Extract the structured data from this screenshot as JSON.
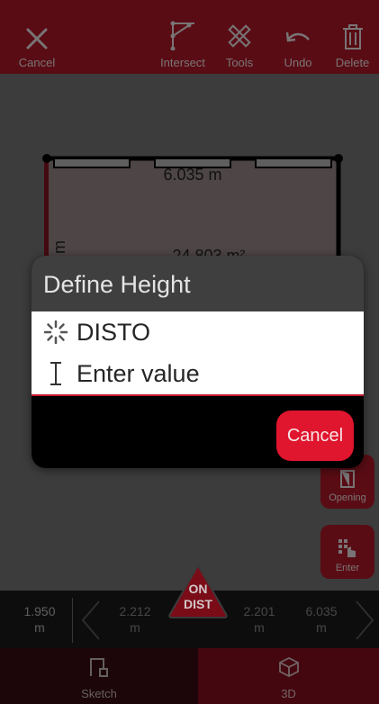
{
  "toolbar": {
    "cancel_label": "Cancel",
    "intersect_label": "Intersect",
    "tools_label": "Tools",
    "undo_label": "Undo",
    "delete_label": "Delete",
    "icons": {
      "cancel": "close-icon",
      "intersect": "intersect-icon",
      "tools": "tools-icon",
      "undo": "undo-icon",
      "delete": "trash-icon"
    }
  },
  "sketch": {
    "top_wall_length": "6.035 m",
    "left_wall_length": "399 m",
    "area": "24.803 m²"
  },
  "side_buttons": {
    "opening_label": "Opening",
    "enter_label": "Enter"
  },
  "dialog": {
    "title": "Define Height",
    "options": [
      {
        "icon": "disto-loading-icon",
        "label": "DISTO"
      },
      {
        "icon": "text-cursor-icon",
        "label": "Enter value"
      }
    ],
    "cancel_label": "Cancel"
  },
  "distances": {
    "current": {
      "value": "1.950",
      "unit": "m"
    },
    "list": [
      {
        "value": "2.212",
        "unit": "m"
      },
      {
        "value": "2.201",
        "unit": "m"
      },
      {
        "value": "6.035",
        "unit": "m"
      }
    ]
  },
  "ondist": {
    "line1": "ON",
    "line2": "DIST"
  },
  "bottom_nav": {
    "sketch_label": "Sketch",
    "three_d_label": "3D"
  },
  "colors": {
    "brand_red": "#b31829",
    "accent_red": "#e0152e",
    "canvas_gray": "#787878"
  }
}
